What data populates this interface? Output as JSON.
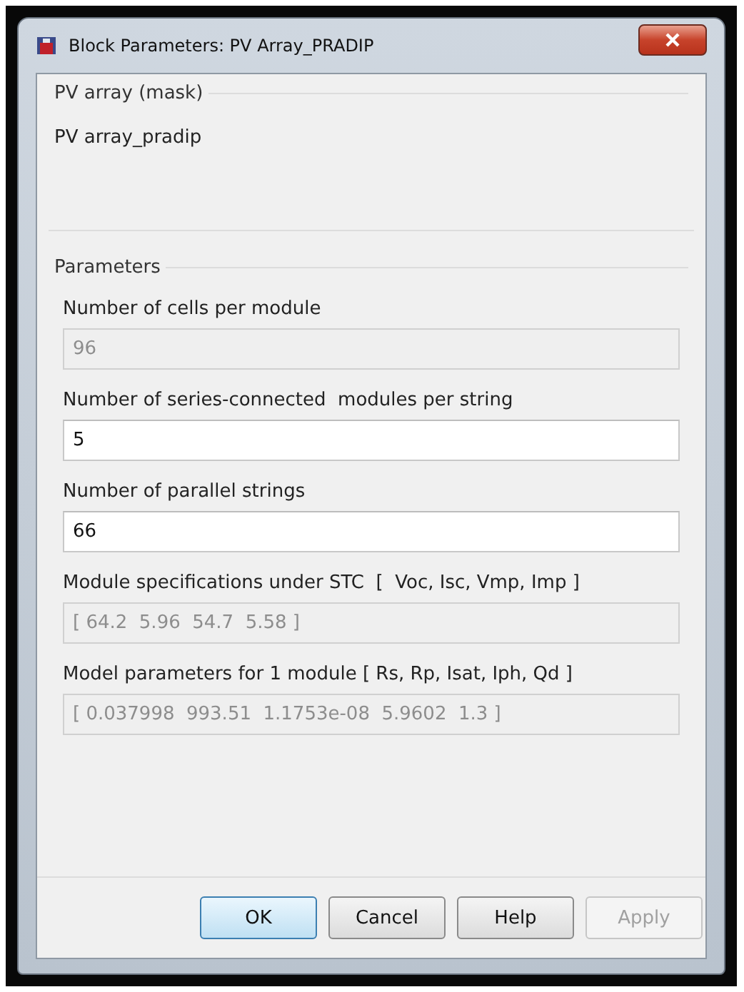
{
  "window": {
    "title": "Block Parameters: PV Array_PRADIP"
  },
  "description": {
    "title": "PV array (mask)",
    "text": "PV array_pradip"
  },
  "parameters": {
    "title": "Parameters",
    "fields": [
      {
        "label": "Number of cells per module",
        "value": "96",
        "disabled": true
      },
      {
        "label": "Number of series-connected  modules per string",
        "value": "5",
        "disabled": false
      },
      {
        "label": "Number of parallel strings",
        "value": "66",
        "disabled": false
      },
      {
        "label": "Module specifications under STC  [  Voc, Isc, Vmp, Imp ]",
        "value": "[ 64.2  5.96  54.7  5.58 ]",
        "disabled": true
      },
      {
        "label": "Model parameters for 1 module [ Rs, Rp, Isat, Iph, Qd ]",
        "value": "[ 0.037998  993.51  1.1753e-08  5.9602  1.3 ]",
        "disabled": true
      }
    ]
  },
  "buttons": [
    {
      "label": "OK",
      "default": true,
      "disabled": false
    },
    {
      "label": "Cancel",
      "default": false,
      "disabled": false
    },
    {
      "label": "Help",
      "default": false,
      "disabled": false
    },
    {
      "label": "Apply",
      "default": false,
      "disabled": true
    }
  ]
}
